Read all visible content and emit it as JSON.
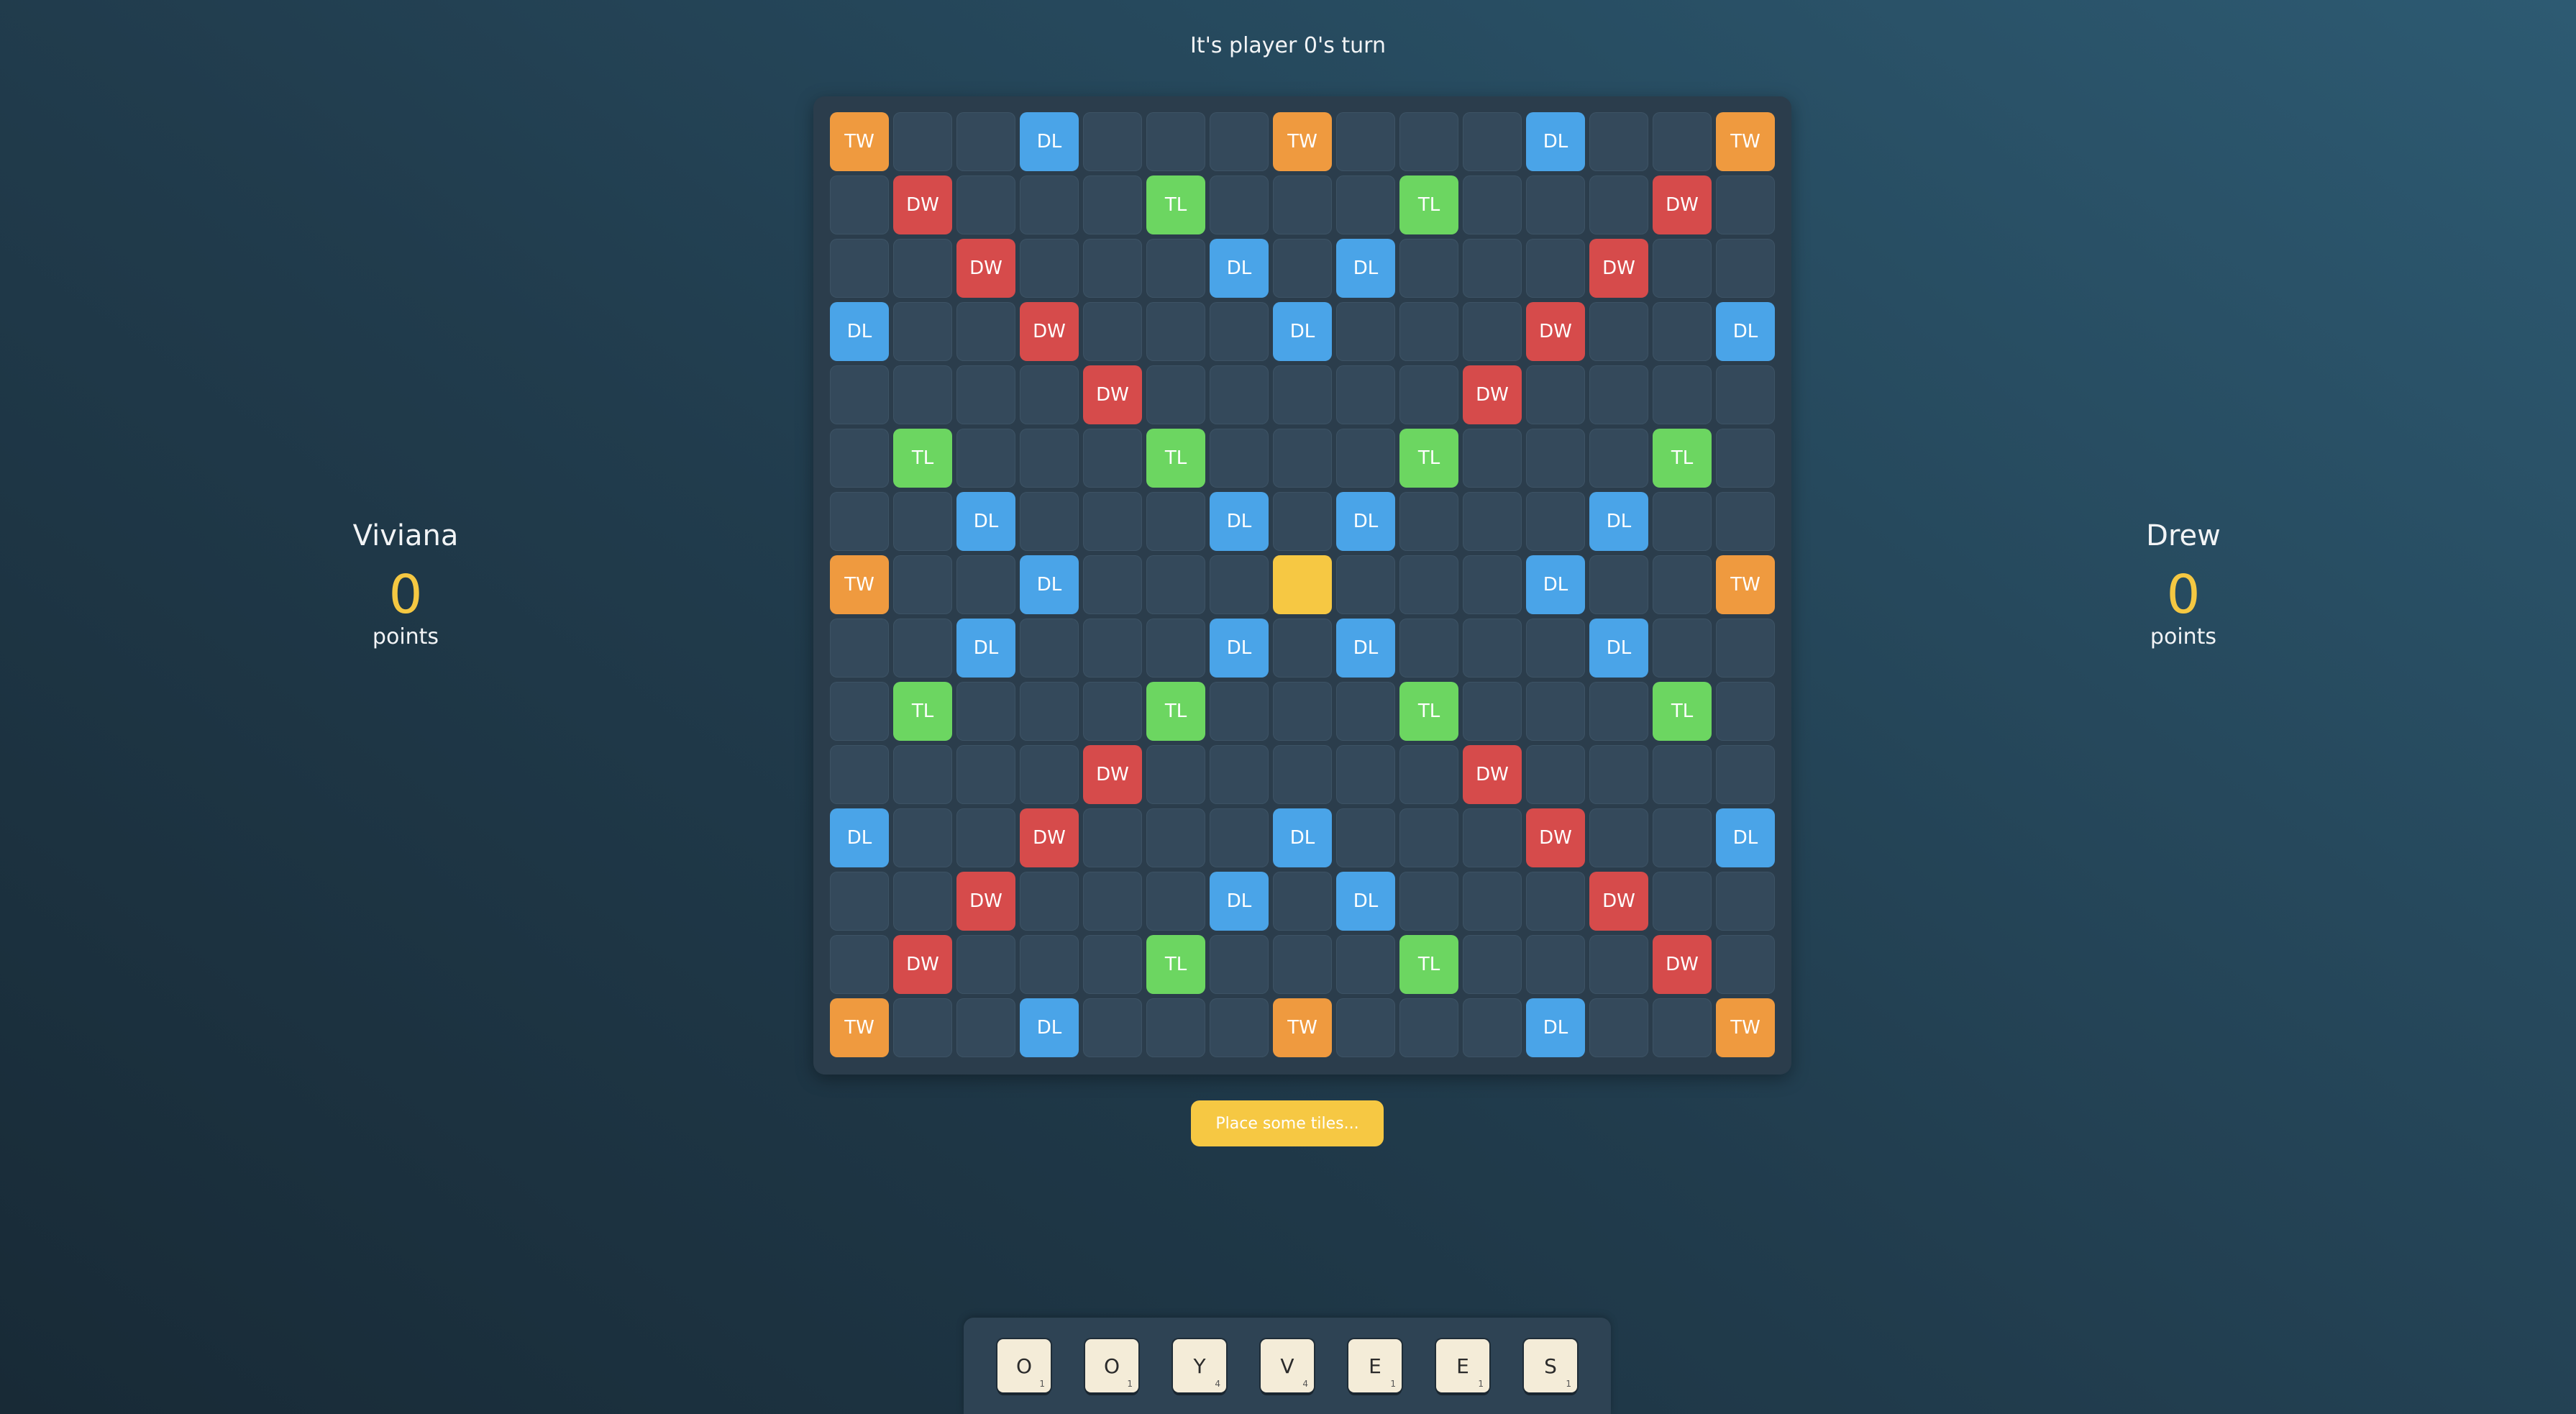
{
  "status": {
    "turn_text": "It's player 0's turn"
  },
  "players": [
    {
      "name": "Viviana",
      "score": "0",
      "points_label": "points"
    },
    {
      "name": "Drew",
      "score": "0",
      "points_label": "points"
    }
  ],
  "board": {
    "rows": [
      [
        "TW",
        "",
        "",
        "DL",
        "",
        "",
        "",
        "TW",
        "",
        "",
        "",
        "DL",
        "",
        "",
        "TW"
      ],
      [
        "",
        "DW",
        "",
        "",
        "",
        "TL",
        "",
        "",
        "",
        "TL",
        "",
        "",
        "",
        "DW",
        ""
      ],
      [
        "",
        "",
        "DW",
        "",
        "",
        "",
        "DL",
        "",
        "DL",
        "",
        "",
        "",
        "DW",
        "",
        ""
      ],
      [
        "DL",
        "",
        "",
        "DW",
        "",
        "",
        "",
        "DL",
        "",
        "",
        "",
        "DW",
        "",
        "",
        "DL"
      ],
      [
        "",
        "",
        "",
        "",
        "DW",
        "",
        "",
        "",
        "",
        "",
        "DW",
        "",
        "",
        "",
        ""
      ],
      [
        "",
        "TL",
        "",
        "",
        "",
        "TL",
        "",
        "",
        "",
        "TL",
        "",
        "",
        "",
        "TL",
        ""
      ],
      [
        "",
        "",
        "DL",
        "",
        "",
        "",
        "DL",
        "",
        "DL",
        "",
        "",
        "",
        "DL",
        "",
        ""
      ],
      [
        "TW",
        "",
        "",
        "DL",
        "",
        "",
        "",
        "CENTER",
        "",
        "",
        "",
        "DL",
        "",
        "",
        "TW"
      ],
      [
        "",
        "",
        "DL",
        "",
        "",
        "",
        "DL",
        "",
        "DL",
        "",
        "",
        "",
        "DL",
        "",
        ""
      ],
      [
        "",
        "TL",
        "",
        "",
        "",
        "TL",
        "",
        "",
        "",
        "TL",
        "",
        "",
        "",
        "TL",
        ""
      ],
      [
        "",
        "",
        "",
        "",
        "DW",
        "",
        "",
        "",
        "",
        "",
        "DW",
        "",
        "",
        "",
        ""
      ],
      [
        "DL",
        "",
        "",
        "DW",
        "",
        "",
        "",
        "DL",
        "",
        "",
        "",
        "DW",
        "",
        "",
        "DL"
      ],
      [
        "",
        "",
        "DW",
        "",
        "",
        "",
        "DL",
        "",
        "DL",
        "",
        "",
        "",
        "DW",
        "",
        ""
      ],
      [
        "",
        "DW",
        "",
        "",
        "",
        "TL",
        "",
        "",
        "",
        "TL",
        "",
        "",
        "",
        "DW",
        ""
      ],
      [
        "TW",
        "",
        "",
        "DL",
        "",
        "",
        "",
        "TW",
        "",
        "",
        "",
        "DL",
        "",
        "",
        "TW"
      ]
    ],
    "colors": {
      "TW": "#ef9a3f",
      "DW": "#d64b4b",
      "TL": "#6cd661",
      "DL": "#4aa4e8",
      "center": "#f6c843",
      "empty": "#34495b"
    }
  },
  "actions": {
    "submit_label": "Place some tiles..."
  },
  "rack": {
    "tiles": [
      {
        "letter": "O",
        "value": "1"
      },
      {
        "letter": "O",
        "value": "1"
      },
      {
        "letter": "Y",
        "value": "4"
      },
      {
        "letter": "V",
        "value": "4"
      },
      {
        "letter": "E",
        "value": "1"
      },
      {
        "letter": "E",
        "value": "1"
      },
      {
        "letter": "S",
        "value": "1"
      }
    ]
  }
}
